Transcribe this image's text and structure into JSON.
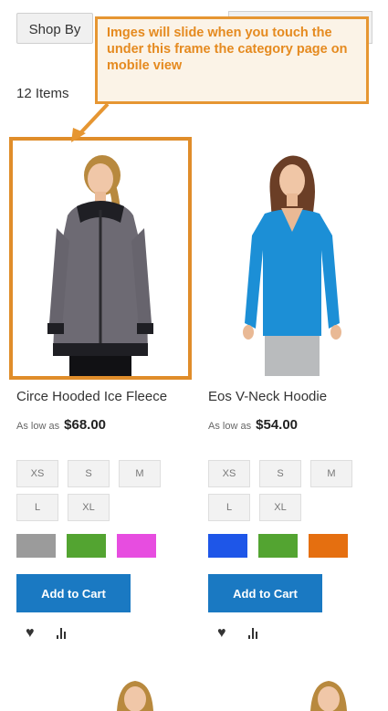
{
  "toolbar": {
    "shop_by_label": "Shop By"
  },
  "annotation": {
    "text": "Imges will slide when you touch the under this frame the category page on mobile view"
  },
  "listing": {
    "item_count": "12 Items"
  },
  "products": [
    {
      "name": "Circe Hooded Ice Fleece",
      "price_prefix": "As low as",
      "price": "$68.00",
      "sizes": [
        "XS",
        "S",
        "M",
        "L",
        "XL"
      ],
      "colors": [
        "#9b9b9b",
        "#53a431",
        "#e74de0"
      ],
      "add_to_cart_label": "Add to Cart"
    },
    {
      "name": "Eos V-Neck Hoodie",
      "price_prefix": "As low as",
      "price": "$54.00",
      "sizes": [
        "XS",
        "S",
        "M",
        "L",
        "XL"
      ],
      "colors": [
        "#1e56e8",
        "#53a431",
        "#e56f10"
      ],
      "add_to_cart_label": "Add to Cart"
    }
  ],
  "colors": {
    "accent_orange": "#e08d2a",
    "button_blue": "#1a79c2"
  }
}
